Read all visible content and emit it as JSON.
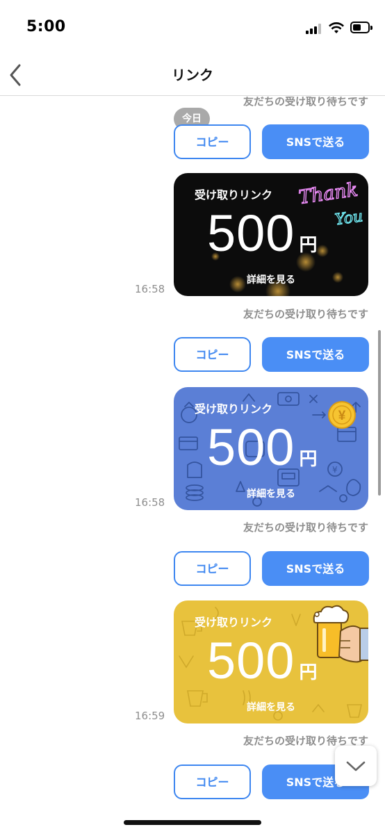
{
  "status_bar": {
    "time": "5:00",
    "battery_level": 0.55
  },
  "header": {
    "title": "リンク",
    "back_icon": "chevron-left-icon"
  },
  "date_badge": "今日",
  "waiting_text": "友だちの受け取り待ちです",
  "buttons": {
    "copy_label": "コピー",
    "sns_label": "SNSで送る"
  },
  "messages": [
    {
      "time": "16:58",
      "design": "thank-you-neon",
      "card": {
        "title": "受け取りリンク",
        "amount": "500",
        "unit": "円",
        "detail_label": "詳細を見る",
        "neon_line1": "Thank",
        "neon_line2": "You"
      }
    },
    {
      "time": "16:58",
      "design": "money-pattern-blue",
      "card": {
        "title": "受け取りリンク",
        "amount": "500",
        "unit": "円",
        "detail_label": "詳細を見る",
        "coin_symbol": "¥"
      }
    },
    {
      "time": "16:59",
      "design": "beer-cheers-yellow",
      "card": {
        "title": "受け取りリンク",
        "amount": "500",
        "unit": "円",
        "detail_label": "詳細を見る"
      }
    }
  ],
  "colors": {
    "accent": "#4a8ef5",
    "muted_text": "#8e8e8e",
    "card_black": "#0c0c0c",
    "card_blue": "#5b7fd6",
    "card_yellow": "#e8c23d"
  },
  "scroll_down_icon": "chevron-down-icon"
}
